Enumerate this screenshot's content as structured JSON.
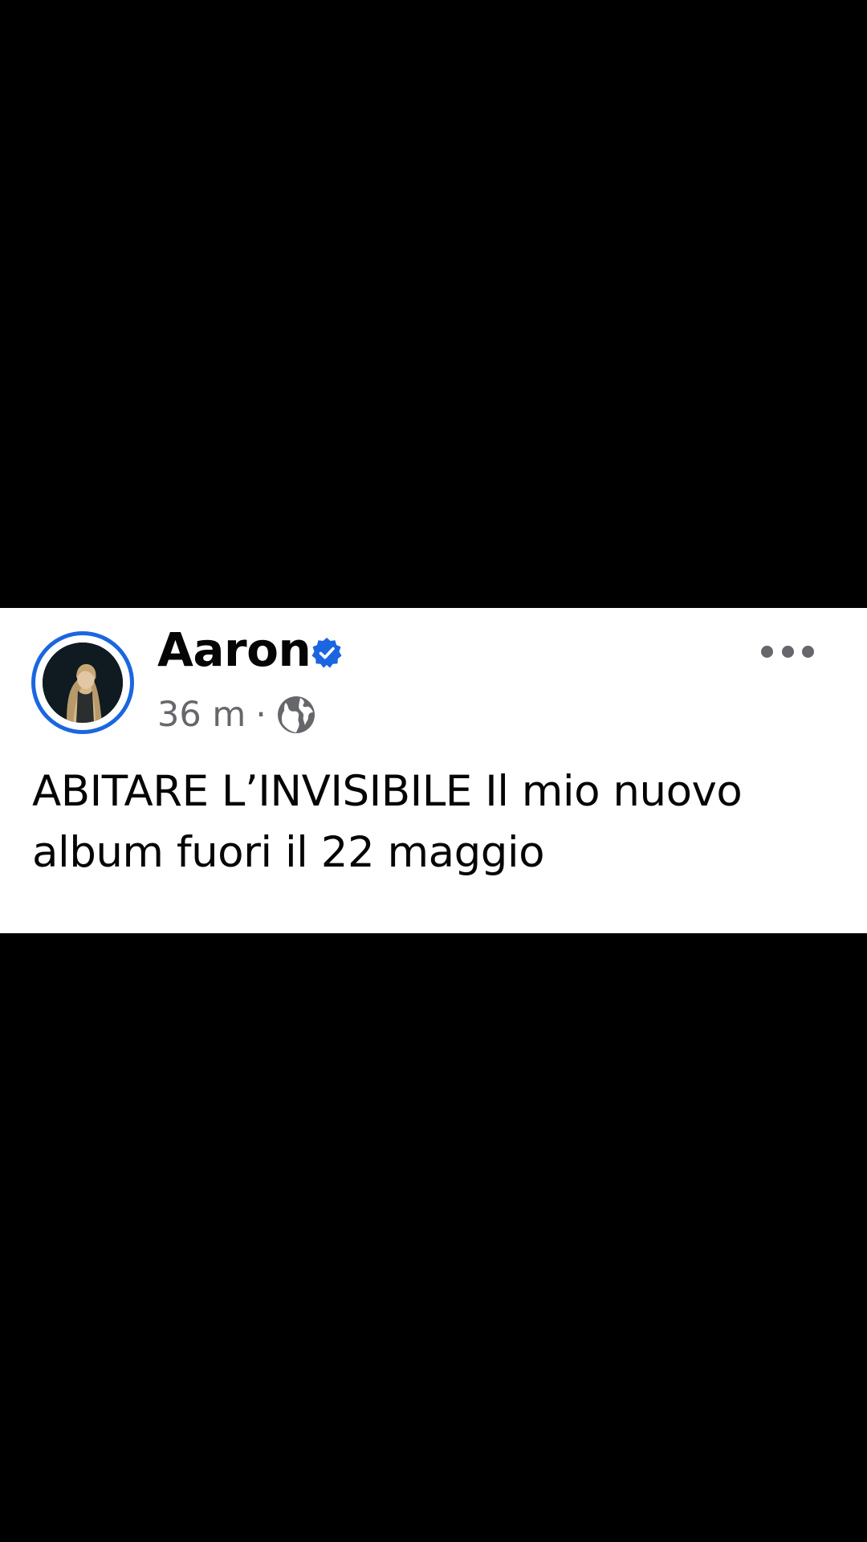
{
  "post": {
    "author_name": "Aaron",
    "verified": true,
    "timestamp": "36 m",
    "separator": "·",
    "audience_icon": "globe-icon",
    "more_icon": "more-options-icon",
    "text": "ABITARE L’INVISIBILE Il mio nuovo album fuori il 22 maggio"
  },
  "colors": {
    "background": "#000000",
    "card": "#ffffff",
    "accent": "#1b66e0",
    "text_primary": "#050505",
    "text_secondary": "#65676b"
  }
}
